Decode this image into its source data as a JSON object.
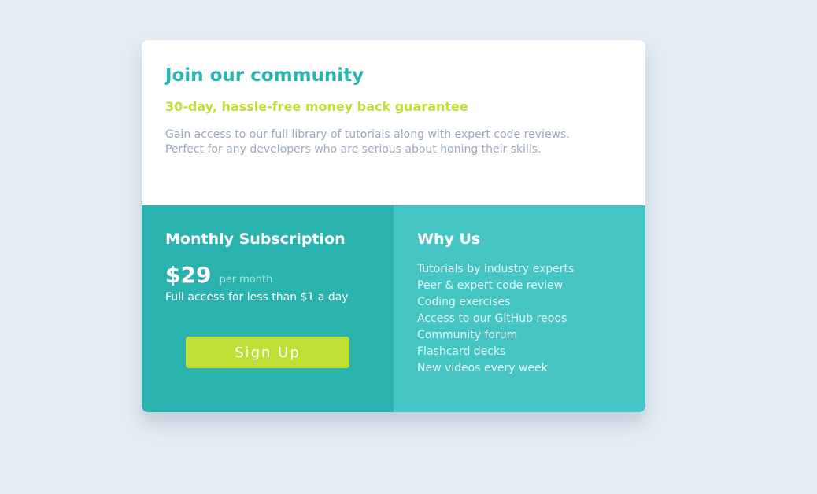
{
  "colors": {
    "background": "#e5edf5",
    "title": "#2bb3b1",
    "guarantee": "#c0df34",
    "description": "#9aa9bb",
    "subscription_panel": "#2ab2ae",
    "why_panel": "#44c4c3",
    "button": "#c0df34"
  },
  "header": {
    "title": "Join our community",
    "guarantee": "30-day, hassle-free money back guarantee",
    "description_lines": [
      "Gain access to our full library of tutorials along with expert code reviews.",
      "Perfect for any developers who are serious about honing their skills."
    ]
  },
  "subscription": {
    "title": "Monthly Subscription",
    "price": "$29",
    "period": "per month",
    "tagline": "Full access for less than $1 a day",
    "button_label": "Sign Up"
  },
  "why_us": {
    "title": "Why Us",
    "items": [
      "Tutorials by industry experts",
      "Peer & expert code review",
      "Coding exercises",
      "Access to our GitHub repos",
      "Community forum",
      "Flashcard decks",
      "New videos every week"
    ]
  }
}
